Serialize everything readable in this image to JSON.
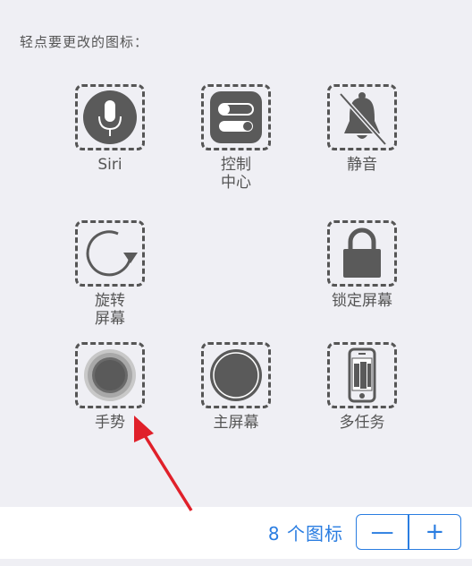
{
  "instruction": "轻点要更改的图标：",
  "icons": [
    {
      "label": "Siri",
      "icon": "microphone-icon"
    },
    {
      "label": "控制\n中心",
      "icon": "control-center-icon"
    },
    {
      "label": "静音",
      "icon": "mute-bell-icon"
    },
    {
      "label": "旋转\n屏幕",
      "icon": "rotate-icon"
    },
    {
      "label": "锁定屏幕",
      "icon": "lock-icon"
    },
    {
      "label": "手势",
      "icon": "gesture-icon"
    },
    {
      "label": "主屏幕",
      "icon": "home-icon"
    },
    {
      "label": "多任务",
      "icon": "multitask-icon"
    }
  ],
  "footer": {
    "count_text": "8 个图标",
    "minus_label": "—",
    "plus_label": "+"
  },
  "colors": {
    "accent": "#2a7de1",
    "icon_gray": "#555555",
    "arrow_red": "#e0202a",
    "background": "#efeff4"
  }
}
